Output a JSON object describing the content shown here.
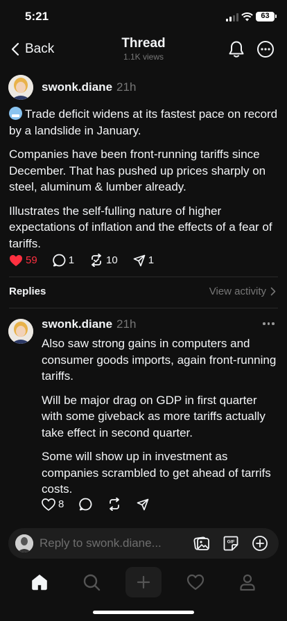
{
  "status": {
    "time": "5:21",
    "battery": "63"
  },
  "header": {
    "back_label": "Back",
    "title": "Thread",
    "subtitle": "1.1K views"
  },
  "post": {
    "author": "swonk.diane",
    "time": "21h",
    "paragraphs": [
      "Trade deficit widens at its fastest pace on record by a landslide in January.",
      "Companies have been front-running tariffs since December. That has pushed up prices sharply on steel, aluminum & lumber already.",
      "Illustrates the self-fulling nature of higher expectations of inflation and the effects of a fear of tariffs."
    ],
    "emoji": "cold-face-emoji",
    "likes": "59",
    "comments": "1",
    "reposts": "10",
    "shares": "1",
    "liked": true
  },
  "replies": {
    "title": "Replies",
    "view_activity": "View activity"
  },
  "reply": {
    "author": "swonk.diane",
    "time": "21h",
    "paragraphs": [
      "Also saw strong gains in computers and consumer goods imports, again front-running tariffs.",
      "Will be major drag on GDP in first quarter with some giveback as more tariffs actually take effect in second quarter.",
      "Some will show up in investment as companies scrambled to get ahead of tarrifs costs."
    ],
    "likes": "8"
  },
  "composer": {
    "placeholder": "Reply to swonk.diane...",
    "gif_label": "GIF"
  },
  "colors": {
    "background": "#101010",
    "like": "#ff3040",
    "muted": "#777777",
    "text": "#f3f5f7"
  },
  "tabs": [
    "home-icon",
    "search-icon",
    "plus-icon",
    "heart-icon",
    "profile-icon"
  ]
}
